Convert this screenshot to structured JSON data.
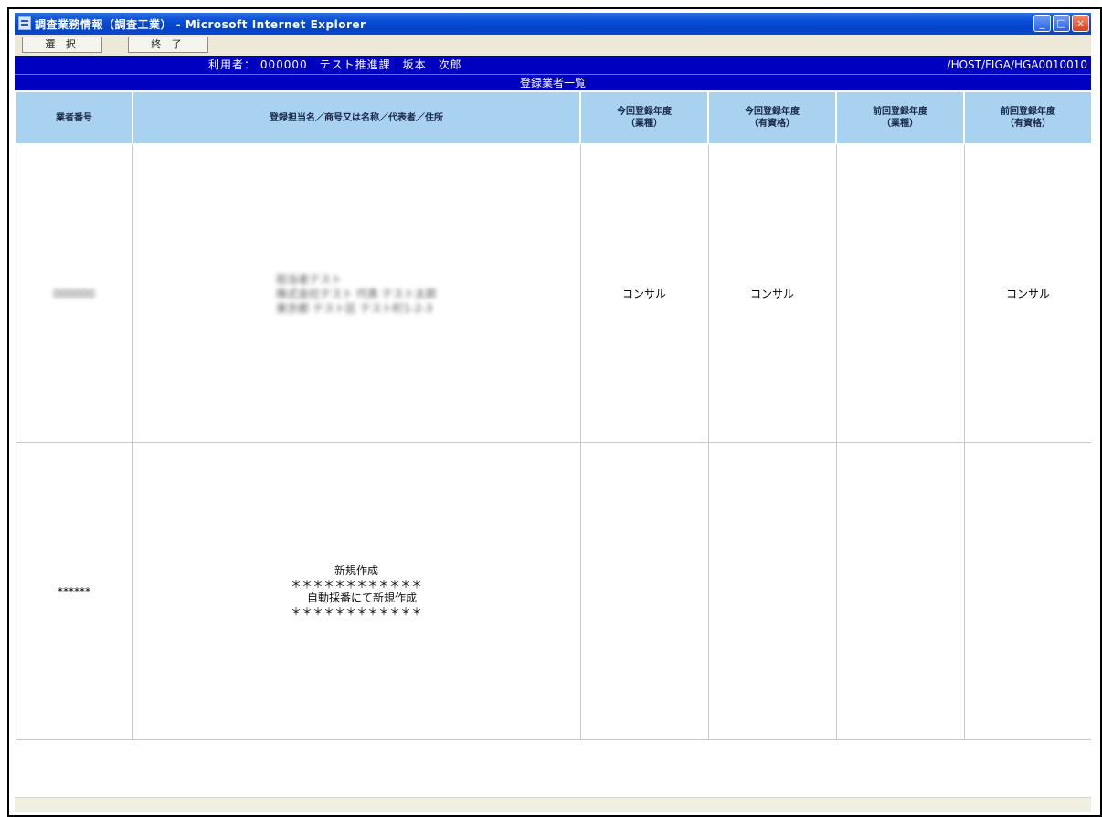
{
  "window": {
    "title": "調査業務情報（調査工業） - Microsoft Internet Explorer",
    "controls": [
      "_",
      "□",
      "×"
    ]
  },
  "toolbar": {
    "buttons": [
      {
        "label": "選 択"
      },
      {
        "label": "終 了"
      }
    ]
  },
  "userbar": {
    "who": "利用者： 000000　テスト推進課　坂本　次郎",
    "path": "/HOST/FIGA/HGA0010010"
  },
  "list_title": "登録業者一覧",
  "table": {
    "headers": [
      "業者番号",
      "登録担当名／商号又は名称／代表者／住所",
      "今回登録年度\n（業種）",
      "今回登録年度\n（有資格）",
      "前回登録年度\n（業種）",
      "前回登録年度\n（有資格）"
    ],
    "rows": [
      {
        "id": "000000",
        "info": [
          "担当者テスト",
          "株式会社テスト 代表 テスト太郎",
          "東京都 テスト区 テスト町1-2-3"
        ],
        "cur_type": "コンサル",
        "cur_qual": "コンサル",
        "prev_type": "",
        "prev_qual": "コンサル"
      },
      {
        "id": "******",
        "notice": "新規作成\n＊＊＊＊＊＊＊＊＊＊＊＊\n　自動採番にて新規作成\n＊＊＊＊＊＊＊＊＊＊＊＊",
        "cur_type": "",
        "cur_qual": "",
        "prev_type": "",
        "prev_qual": ""
      }
    ]
  }
}
